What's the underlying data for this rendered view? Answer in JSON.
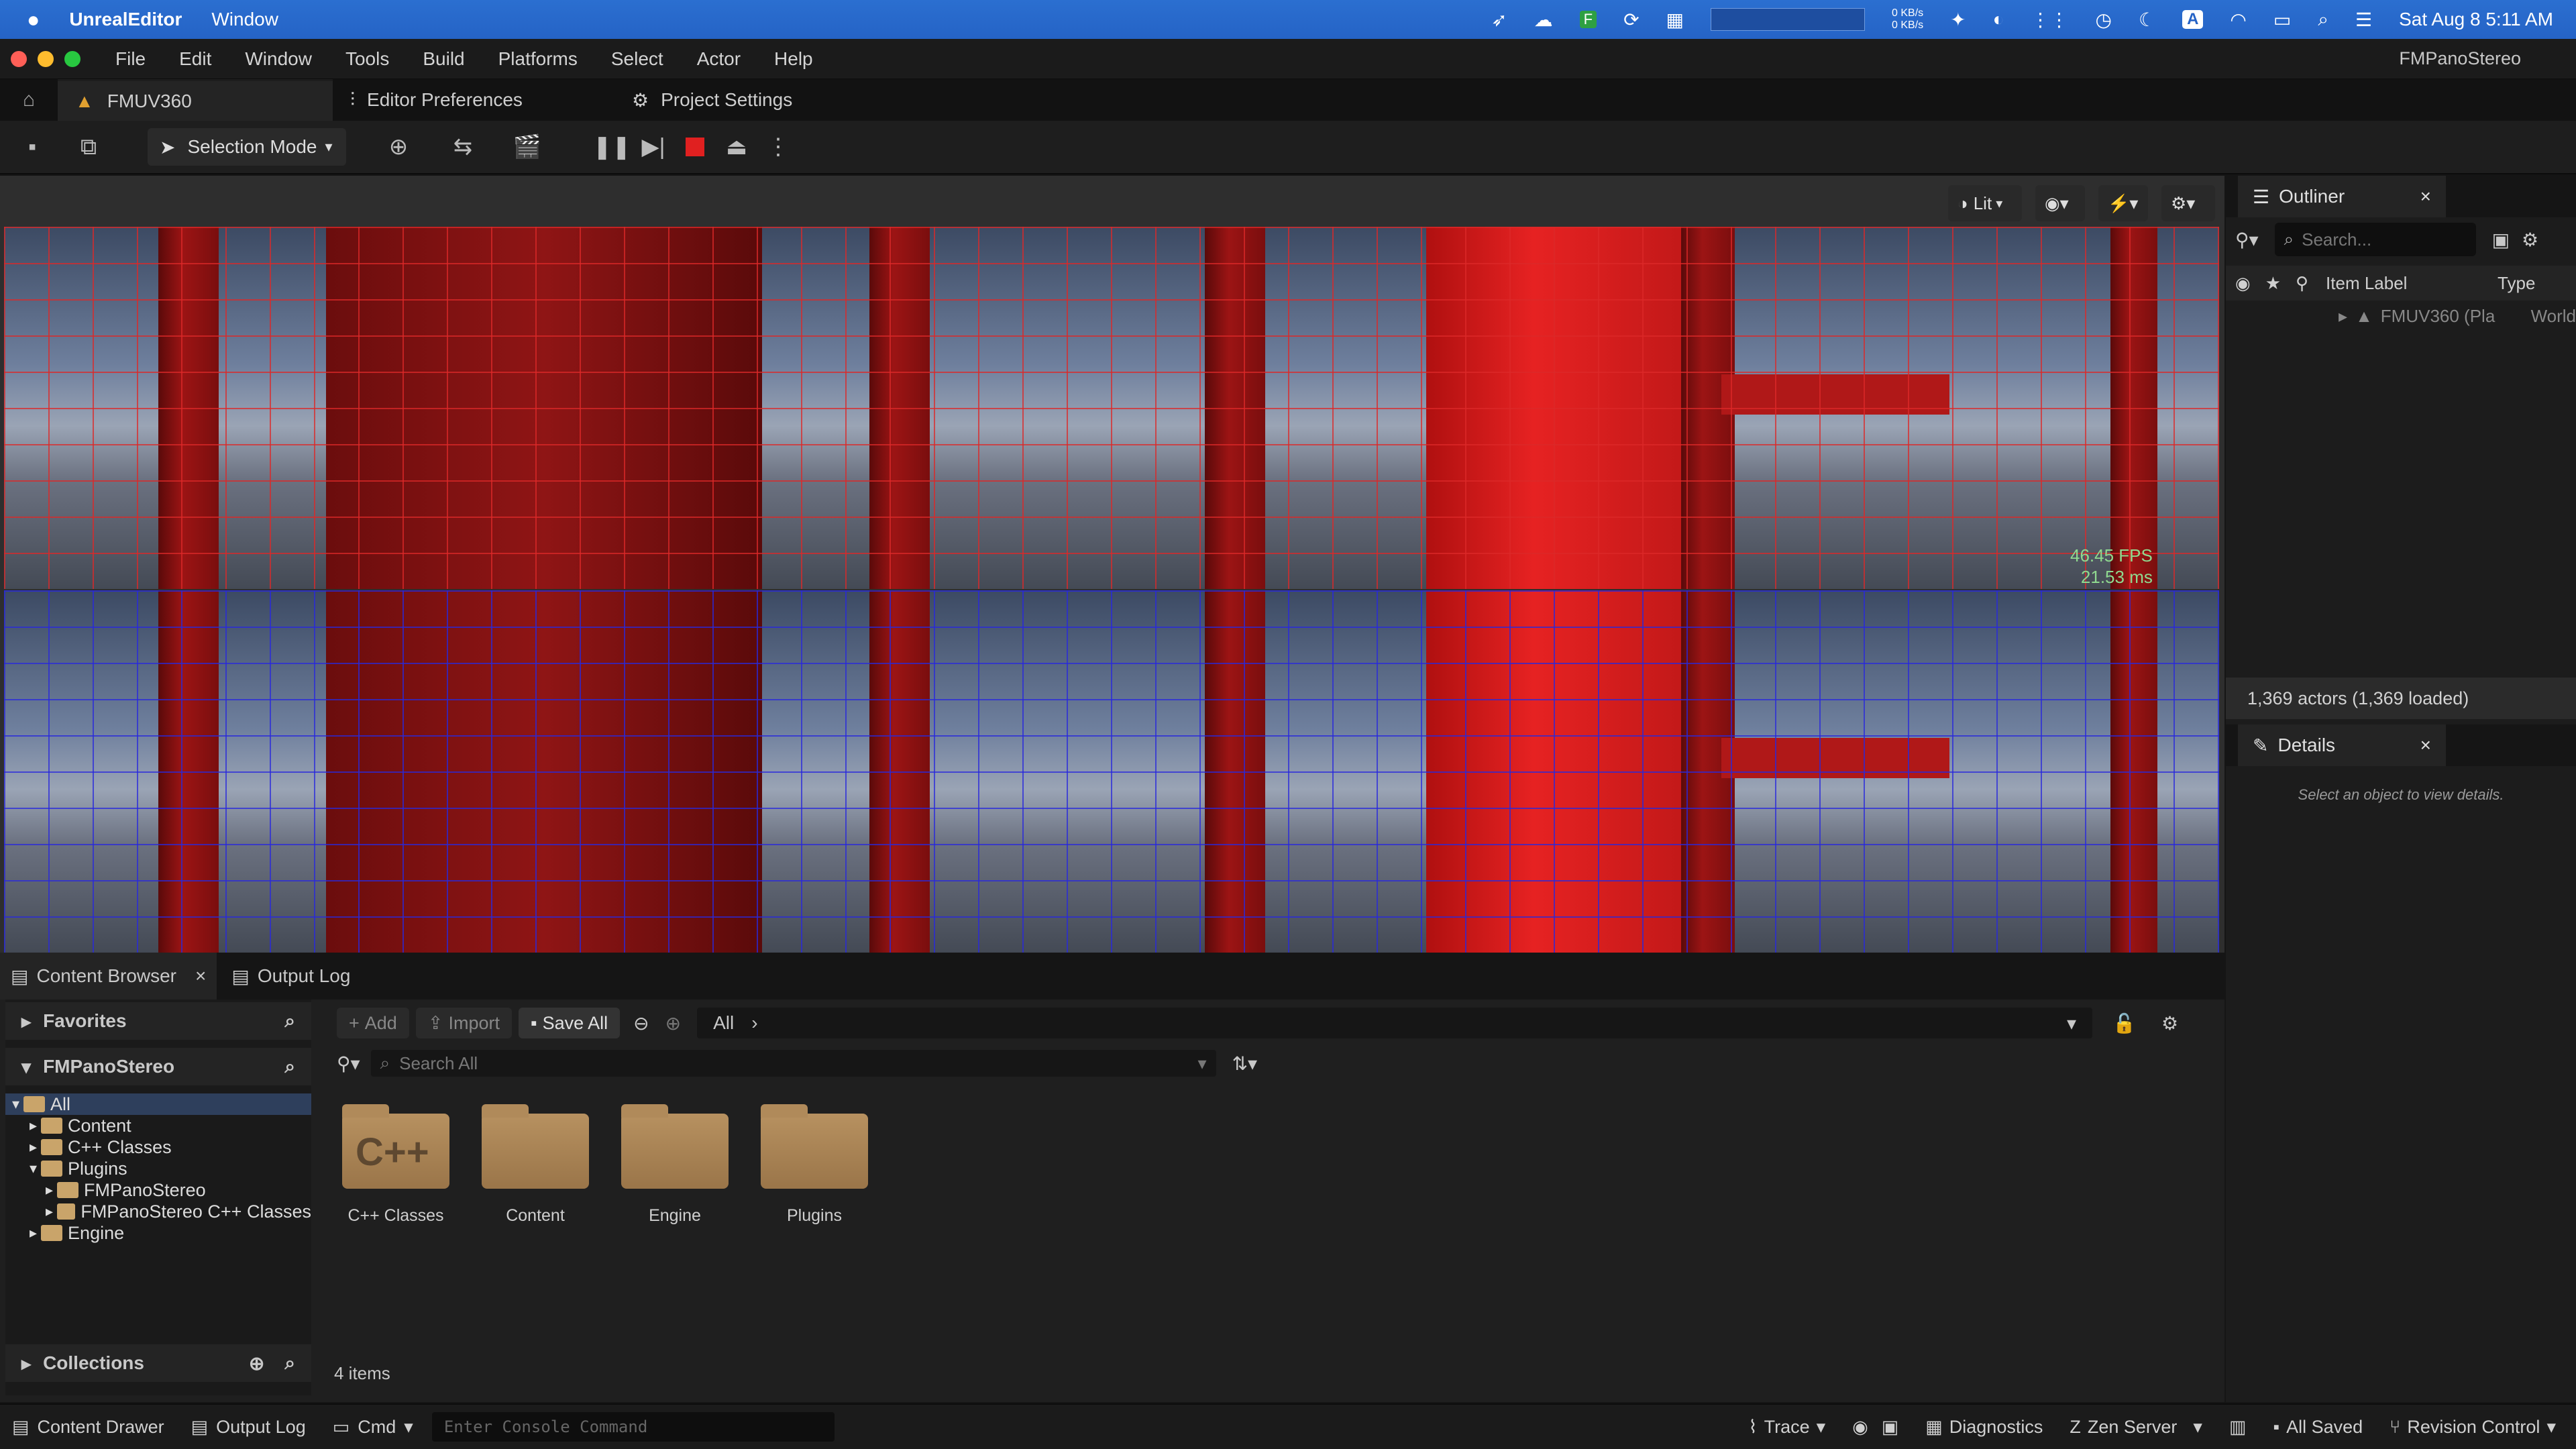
{
  "mac_menubar": {
    "app_name": "UnrealEditor",
    "menus": [
      "Window"
    ],
    "network": [
      "0 KB/s",
      "0 KB/s"
    ],
    "datetime": "Sat Aug 8  5:11 AM"
  },
  "window": {
    "menus": [
      "File",
      "Edit",
      "Window",
      "Tools",
      "Build",
      "Platforms",
      "Select",
      "Actor",
      "Help"
    ],
    "project_name": "FMPanoStereo"
  },
  "tabs": [
    {
      "label": "FMUV360",
      "active": true
    },
    {
      "label": "Editor Preferences",
      "active": false
    },
    {
      "label": "Project Settings",
      "active": false
    }
  ],
  "toolbar": {
    "selection_mode": "Selection Mode"
  },
  "viewport": {
    "view_mode": "Lit",
    "fps": "46.45 FPS",
    "ms": "21.53 ms"
  },
  "outliner": {
    "title": "Outliner",
    "search_placeholder": "Search...",
    "col_label": "Item Label",
    "col_type": "Type",
    "rows": [
      {
        "label": "FMUV360 (Pla",
        "type": "World"
      }
    ],
    "actors_count": "1,369 actors (1,369 loaded)"
  },
  "details": {
    "title": "Details",
    "empty_text": "Select an object to view details."
  },
  "content_browser": {
    "tab_label": "Content Browser",
    "output_log_tab": "Output Log",
    "favorites": "Favorites",
    "project": "FMPanoStereo",
    "tree": [
      {
        "label": "All",
        "level": 0,
        "selected": true
      },
      {
        "label": "Content",
        "level": 1
      },
      {
        "label": "C++ Classes",
        "level": 1
      },
      {
        "label": "Plugins",
        "level": 1
      },
      {
        "label": "FMPanoStereo",
        "level": 2
      },
      {
        "label": "FMPanoStereo C++ Classes",
        "level": 2
      },
      {
        "label": "Engine",
        "level": 1
      }
    ],
    "collections": "Collections",
    "add": "Add",
    "import": "Import",
    "save_all": "Save All",
    "path": "All",
    "search_placeholder": "Search All",
    "folders": [
      "C++ Classes",
      "Content",
      "Engine",
      "Plugins"
    ],
    "cpp_glyph": "C++",
    "item_count": "4 items"
  },
  "statusbar": {
    "content_drawer": "Content Drawer",
    "output_log": "Output Log",
    "cmd": "Cmd",
    "console_placeholder": "Enter Console Command",
    "trace": "Trace",
    "diagnostics": "Diagnostics",
    "zen_server": "Zen Server",
    "all_saved": "All Saved",
    "revision_control": "Revision Control"
  }
}
